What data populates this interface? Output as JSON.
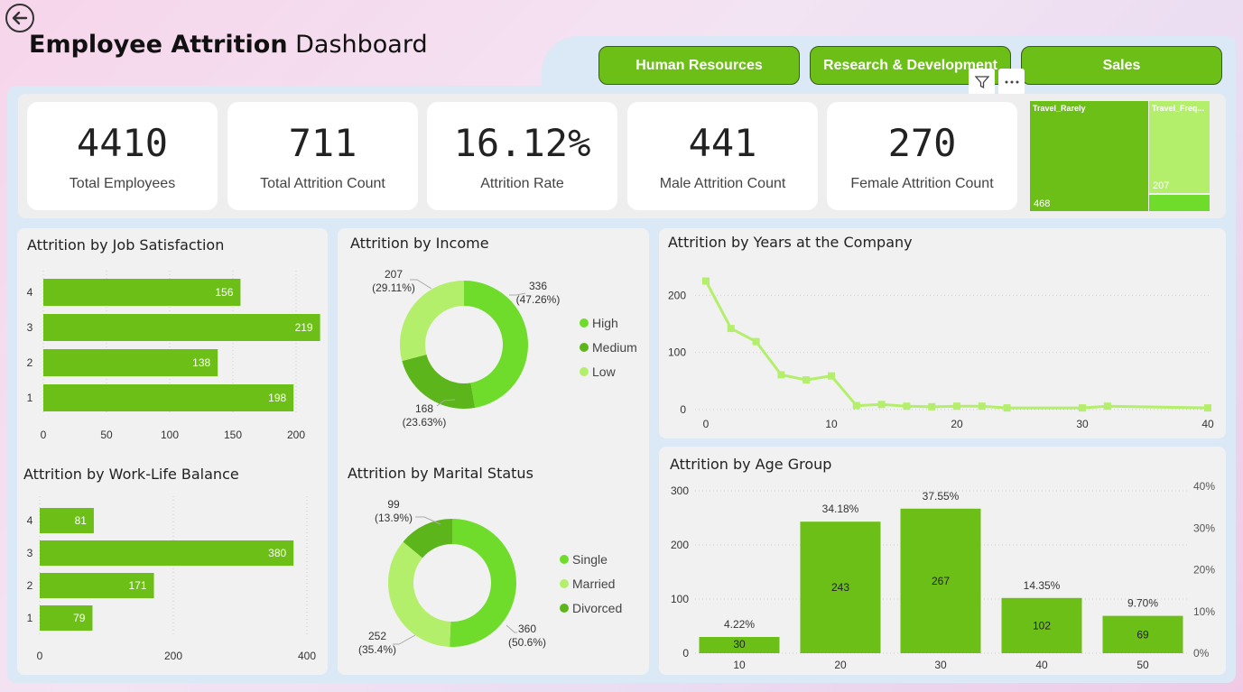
{
  "header": {
    "title_bold": "Employee Attrition",
    "title_rest": " Dashboard"
  },
  "departments": [
    "Human Resources",
    "Research & Development",
    "Sales"
  ],
  "kpis": [
    {
      "value": "4410",
      "label": "Total Employees"
    },
    {
      "value": "711",
      "label": "Total Attrition Count"
    },
    {
      "value": "16.12%",
      "label": "Attrition Rate"
    },
    {
      "value": "441",
      "label": "Male Attrition Count"
    },
    {
      "value": "270",
      "label": "Female Attrition Count"
    }
  ],
  "treemap": {
    "items": [
      {
        "name": "Travel_Rarely",
        "value": "468",
        "color": "#6cbf16"
      },
      {
        "name": "Travel_Freq...",
        "value": "207",
        "color": "#b3ef6a"
      },
      {
        "name": "",
        "value": "",
        "color": "#6fdc2c"
      }
    ]
  },
  "colors": {
    "bar": "#6cbf16",
    "high": "#6fdc2c",
    "medium": "#5cb51b",
    "low": "#b3ef6a",
    "line": "#b3ef6a"
  },
  "chart_data": [
    {
      "type": "bar",
      "title": "Attrition by Job Satisfaction",
      "orientation": "horizontal",
      "categories": [
        "4",
        "3",
        "2",
        "1"
      ],
      "values": [
        156,
        219,
        138,
        198
      ],
      "xticks": [
        "0",
        "50",
        "100",
        "150",
        "200"
      ],
      "xlim": [
        0,
        220
      ]
    },
    {
      "type": "bar",
      "title": "Attrition by Work-Life Balance",
      "orientation": "horizontal",
      "categories": [
        "4",
        "3",
        "2",
        "1"
      ],
      "values": [
        81,
        380,
        171,
        79
      ],
      "xticks": [
        "0",
        "200",
        "400"
      ],
      "xlim": [
        0,
        400
      ]
    },
    {
      "type": "pie",
      "title": "Attrition by Income",
      "donut": true,
      "slices": [
        {
          "name": "High",
          "value": 336,
          "label": "336",
          "pct": "(47.26%)"
        },
        {
          "name": "Medium",
          "value": 168,
          "label": "168",
          "pct": "(23.63%)"
        },
        {
          "name": "Low",
          "value": 207,
          "label": "207",
          "pct": "(29.11%)"
        }
      ],
      "legend": [
        "High",
        "Medium",
        "Low"
      ]
    },
    {
      "type": "pie",
      "title": "Attrition by Marital Status",
      "donut": true,
      "slices": [
        {
          "name": "Single",
          "value": 360,
          "label": "360",
          "pct": "(50.6%)"
        },
        {
          "name": "Married",
          "value": 252,
          "label": "252",
          "pct": "(35.4%)"
        },
        {
          "name": "Divorced",
          "value": 99,
          "label": "99",
          "pct": "(13.9%)"
        }
      ],
      "legend": [
        "Single",
        "Married",
        "Divorced"
      ]
    },
    {
      "type": "line",
      "title": "Attrition by Years at the Company",
      "x": [
        0,
        2,
        4,
        6,
        8,
        10,
        12,
        14,
        16,
        18,
        20,
        22,
        24,
        30,
        32,
        40
      ],
      "y": [
        225,
        142,
        119,
        61,
        52,
        59,
        7,
        9,
        6,
        5,
        6,
        6,
        3,
        3,
        6,
        3
      ],
      "xticks": [
        "0",
        "10",
        "20",
        "30",
        "40"
      ],
      "yticks": [
        "0",
        "100",
        "200"
      ],
      "xlim": [
        0,
        40
      ],
      "ylim": [
        0,
        240
      ]
    },
    {
      "type": "bar",
      "title": "Attrition by Age Group",
      "categories": [
        "10",
        "20",
        "30",
        "40",
        "50"
      ],
      "values": [
        30,
        243,
        267,
        102,
        69
      ],
      "rates": [
        "4.22%",
        "34.18%",
        "37.55%",
        "14.35%",
        "9.70%"
      ],
      "yticks": [
        "0",
        "100",
        "200",
        "300"
      ],
      "y2ticks": [
        "0%",
        "10%",
        "20%",
        "30%",
        "40%"
      ],
      "ylim": [
        0,
        300
      ]
    }
  ]
}
